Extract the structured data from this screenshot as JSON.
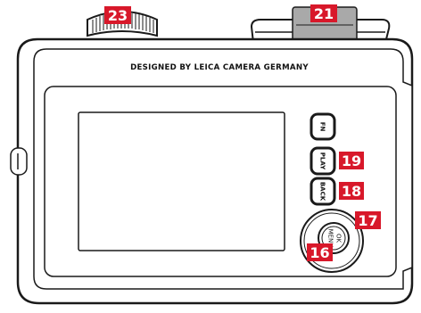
{
  "brand_text": "DESIGNED BY LEICA CAMERA GERMANY",
  "buttons": {
    "fn": "FN",
    "play": "PLAY",
    "back": "BACK",
    "menu": "MENU",
    "ok": "OK"
  },
  "callouts": {
    "dial": "23",
    "flash": "21",
    "play": "19",
    "back": "18",
    "pad": "17",
    "menu_ok": "16"
  },
  "colors": {
    "callout": "#d8182a",
    "outline": "#1a1a1a",
    "flash_gray": "#a9a9a9"
  }
}
